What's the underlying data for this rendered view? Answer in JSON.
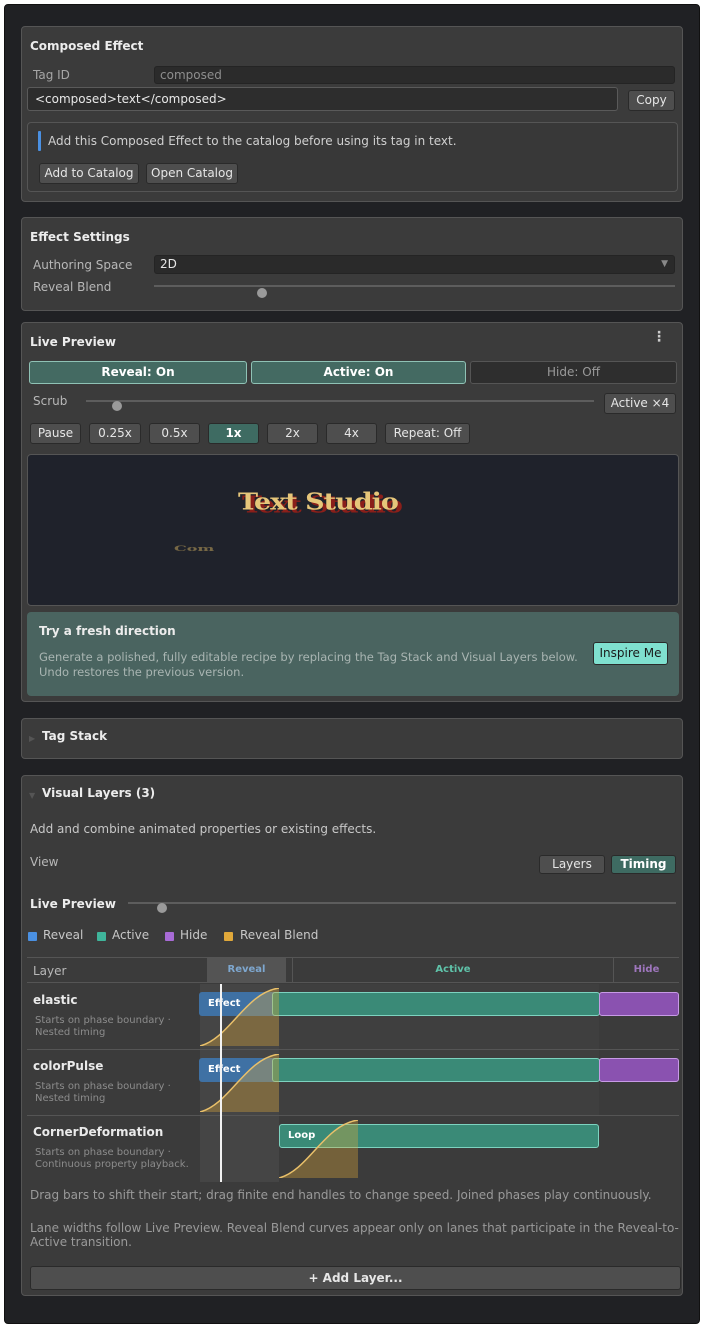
{
  "composed_effect": {
    "title": "Composed Effect",
    "tag_id_label": "Tag ID",
    "tag_id_value": "composed",
    "tag_markup": "<composed>text</composed>",
    "copy_label": "Copy",
    "info_text": "Add this Composed Effect to the catalog before using its tag in text.",
    "add_catalog_label": "Add to Catalog",
    "open_catalog_label": "Open Catalog"
  },
  "effect_settings": {
    "title": "Effect Settings",
    "authoring_space_label": "Authoring Space",
    "authoring_space_value": "2D",
    "reveal_blend_label": "Reveal Blend",
    "reveal_blend_value": 0.2
  },
  "live_preview": {
    "title": "Live Preview",
    "reveal_toggle": "Reveal: On",
    "active_toggle": "Active: On",
    "hide_toggle": "Hide: Off",
    "scrub_label": "Scrub",
    "scrub_value": 0.06,
    "active_count": "Active ×4",
    "pause_label": "Pause",
    "speeds": [
      "0.25x",
      "0.5x",
      "1x",
      "2x",
      "4x"
    ],
    "selected_speed": "1x",
    "repeat_label": "Repeat: Off",
    "preview_text": "Text Studio",
    "preview_text_secondary": "Com",
    "inspire": {
      "title": "Try a fresh direction",
      "body_line1": "Generate a polished, fully editable recipe by replacing the Tag Stack and Visual Layers below.",
      "body_line2": "Undo restores the previous version.",
      "button": "Inspire Me"
    }
  },
  "tag_stack": {
    "title": "Tag Stack"
  },
  "visual_layers": {
    "title": "Visual Layers (3)",
    "description": "Add and combine animated properties or existing effects.",
    "view_label": "View",
    "view_layers": "Layers",
    "view_timing": "Timing",
    "live_preview_label": "Live Preview",
    "live_preview_value": 0.06,
    "legend": [
      {
        "name": "Reveal",
        "color": "#4a90e2"
      },
      {
        "name": "Active",
        "color": "#3fb59b"
      },
      {
        "name": "Hide",
        "color": "#a86bd6"
      },
      {
        "name": "Reveal Blend",
        "color": "#e0a83a"
      }
    ],
    "columns": {
      "layer": "Layer",
      "reveal": "Reveal",
      "active": "Active",
      "hide": "Hide"
    },
    "lanes": [
      {
        "name": "elastic",
        "desc1": "Starts on phase boundary ·",
        "desc2": "Nested timing",
        "bar_label": "Effect"
      },
      {
        "name": "colorPulse",
        "desc1": "Starts on phase boundary ·",
        "desc2": "Nested timing",
        "bar_label": "Effect"
      },
      {
        "name": "CornerDeformation",
        "desc1": "Starts on phase boundary ·",
        "desc2": "Continuous property playback.",
        "bar_label": "Loop"
      }
    ],
    "help1": "Drag bars to shift their start; drag finite end handles to change speed. Joined phases play continuously.",
    "help2_line1": "Lane widths follow Live Preview. Reveal Blend curves appear only on lanes that participate in the Reveal-to-",
    "help2_line2": "Active transition.",
    "add_layer": "+ Add Layer..."
  }
}
